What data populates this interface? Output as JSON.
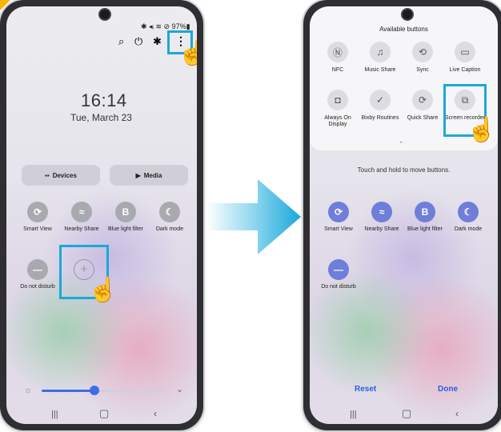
{
  "left_phone": {
    "status": "✱ ◂ᵢ ≋ ⊘ 97%▮",
    "clock": "16:14",
    "date": "Tue, March 23",
    "devices_label": "Devices",
    "media_label": "Media",
    "tiles": [
      {
        "label": "Smart View",
        "icon": "smart-view-icon"
      },
      {
        "label": "Nearby Share",
        "icon": "nearby-share-icon"
      },
      {
        "label": "Blue light filter",
        "icon": "blue-light-icon"
      },
      {
        "label": "Dark mode",
        "icon": "dark-mode-icon"
      },
      {
        "label": "Do not disturb",
        "icon": "do-not-disturb-icon"
      }
    ]
  },
  "right_phone": {
    "available_title": "Available buttons",
    "available": [
      {
        "label": "NFC",
        "icon": "nfc-icon"
      },
      {
        "label": "Music Share",
        "icon": "music-share-icon"
      },
      {
        "label": "Sync",
        "icon": "sync-icon"
      },
      {
        "label": "Live Caption",
        "icon": "live-caption-icon"
      },
      {
        "label": "Always On Display",
        "icon": "always-on-display-icon"
      },
      {
        "label": "Bixby Routines",
        "icon": "bixby-routines-icon"
      },
      {
        "label": "Quick Share",
        "icon": "quick-share-icon"
      },
      {
        "label": "Screen recorder",
        "icon": "screen-recorder-icon"
      }
    ],
    "hint": "Touch and hold to move buttons.",
    "tiles": [
      {
        "label": "Smart View"
      },
      {
        "label": "Nearby Share"
      },
      {
        "label": "Blue light filter"
      },
      {
        "label": "Dark mode"
      },
      {
        "label": "Do not disturb"
      }
    ],
    "reset_label": "Reset",
    "done_label": "Done"
  },
  "colors": {
    "highlight": "#1da7d8",
    "arrow": "#1da7d8",
    "accent_text": "#2b5fd9"
  }
}
